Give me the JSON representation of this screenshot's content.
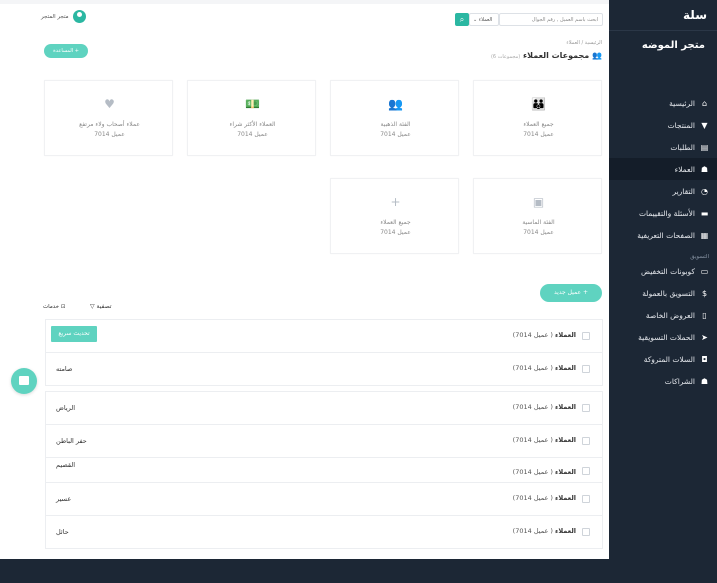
{
  "sidebar": {
    "brand": "سلة",
    "store_name": "متجر الموضه",
    "items": [
      {
        "label": "الرئيسية",
        "icon": "home-icon"
      },
      {
        "label": "المنتجات",
        "icon": "shirt-icon"
      },
      {
        "label": "الطلبات",
        "icon": "inbox-icon"
      },
      {
        "label": "العملاء",
        "icon": "users-icon"
      },
      {
        "label": "التقارير",
        "icon": "pie-chart-icon"
      },
      {
        "label": "الأسئلة والتقييمات",
        "icon": "chat-icon"
      },
      {
        "label": "الصفحات التعريفية",
        "icon": "document-icon"
      }
    ],
    "section_label": "التسويق",
    "marketing_items": [
      {
        "label": "كوبونات التخفيض",
        "icon": "coupon-icon"
      },
      {
        "label": "التسويق بالعمولة",
        "icon": "dollar-icon"
      },
      {
        "label": "العروض الخاصة",
        "icon": "gift-icon"
      },
      {
        "label": "الحملات التسويقية",
        "icon": "send-icon"
      },
      {
        "label": "السلات المتروكة",
        "icon": "cart-icon"
      },
      {
        "label": "الشراكات",
        "icon": "partners-icon"
      }
    ]
  },
  "header": {
    "store_label": "متجر المتجر",
    "search_placeholder": "ابحث باسم العميل , رقم الجوال",
    "search_select": "العملاء"
  },
  "page": {
    "breadcrumb": "الرئيسية / العملاء",
    "title": "مجموعات العملاء",
    "subtitle": "(مجموعات 6)",
    "help_label": "المساعدة +"
  },
  "cards": [
    {
      "title": "جميع العملاء",
      "count": "7014 عميل",
      "icon": "group-icon"
    },
    {
      "title": "الفئة الذهبية",
      "count": "7014 عميل",
      "icon": "people-icon"
    },
    {
      "title": "العملاء الأكثر شراء",
      "count": "7014 عميل",
      "icon": "money-icon"
    },
    {
      "title": "عملاء أصحاب ولاء مرتفع",
      "count": "7014 عميل",
      "icon": "heart-pulse-icon"
    },
    {
      "title": "الفئة الماسية",
      "count": "7014 عميل",
      "icon": "diamond-icon"
    },
    {
      "title": "جميع العملاء",
      "count": "7014 عميل",
      "icon": "plus-icon"
    }
  ],
  "actions": {
    "new_label": "عميل جديد +",
    "filter_label": "تصفية",
    "services_label": "خدمات"
  },
  "rows": [
    {
      "label": "العملاء",
      "count": "( عميل 7014)",
      "name": "",
      "tag": "تحديث سريع"
    },
    {
      "label": "العملاء",
      "count": "( عميل 7014)",
      "name": "صامته",
      "tag": ""
    },
    {
      "label": "العملاء",
      "count": "( عميل 7014)",
      "name": "الرياض",
      "tag": ""
    },
    {
      "label": "العملاء",
      "count": "( عميل 7014)",
      "name": "حفر الباطن",
      "tag": ""
    },
    {
      "label": "العملاء",
      "count": "( عميل 7014)",
      "name": "القصيم",
      "tag": ""
    },
    {
      "label": "العملاء",
      "count": "( عميل 7014)",
      "name": "عسير",
      "tag": ""
    },
    {
      "label": "العملاء",
      "count": "( عميل 7014)",
      "name": "حائل",
      "tag": ""
    }
  ],
  "colors": {
    "accent": "#5fd3c0",
    "sidebar": "#1c2735"
  }
}
